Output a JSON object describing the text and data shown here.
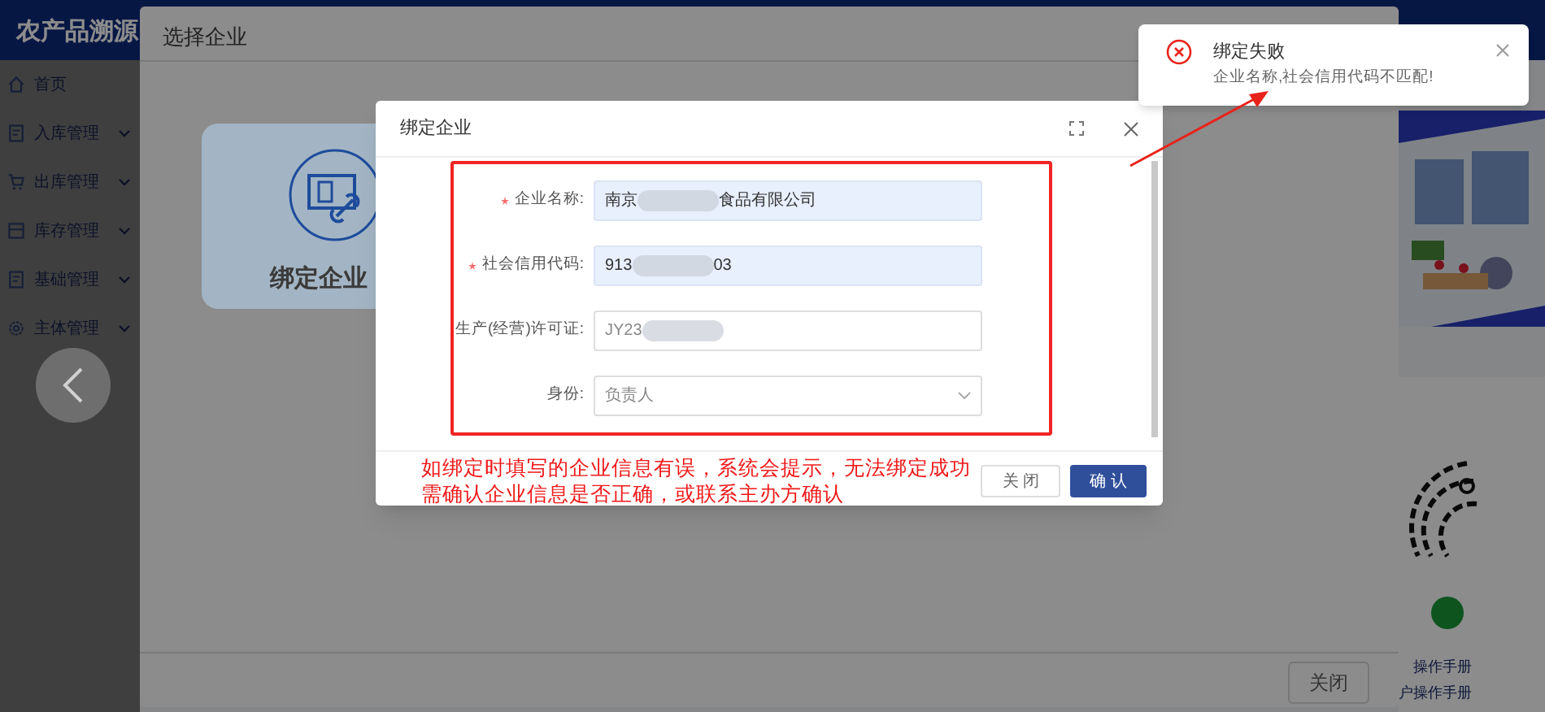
{
  "app": {
    "title": "农产品溯源"
  },
  "sidebar": {
    "items": [
      {
        "label": "首页",
        "kind": "home",
        "expandable": false
      },
      {
        "label": "入库管理",
        "kind": "doc",
        "expandable": true
      },
      {
        "label": "出库管理",
        "kind": "cart",
        "expandable": true
      },
      {
        "label": "库存管理",
        "kind": "box",
        "expandable": true
      },
      {
        "label": "基础管理",
        "kind": "doc",
        "expandable": true
      },
      {
        "label": "主体管理",
        "kind": "gear",
        "expandable": true
      }
    ]
  },
  "side_panel": {
    "links": [
      "操作手册",
      "户操作手册"
    ]
  },
  "outer_dialog": {
    "title": "选择企业",
    "card": {
      "label": "绑定企业"
    },
    "close_button": "关闭"
  },
  "bind_dialog": {
    "title": "绑定企业",
    "fields": [
      {
        "label": "企业名称:",
        "required": true,
        "kind": "input",
        "filled": true,
        "value_start": "南京",
        "value_end": "食品有限公司"
      },
      {
        "label": "社会信用代码:",
        "required": true,
        "kind": "input",
        "filled": true,
        "value_start": "913",
        "value_end": "03"
      },
      {
        "label": "生产(经营)许可证:",
        "required": false,
        "kind": "input",
        "filled": false,
        "value_start": "JY23"
      },
      {
        "label": "身份:",
        "required": false,
        "kind": "select",
        "filled": false,
        "value_start": "负责人"
      }
    ],
    "buttons": [
      {
        "label": "关 闭",
        "primary": false
      },
      {
        "label": "确 认",
        "primary": true
      }
    ]
  },
  "annotation": {
    "lines": [
      "如绑定时填写的企业信息有误，系统会提示，无法绑定成功",
      "需确认企业信息是否正确，或联系主办方确认"
    ]
  },
  "toast": {
    "kind": "error",
    "title": "绑定失败",
    "message": "企业名称,社会信用代码不匹配!"
  }
}
